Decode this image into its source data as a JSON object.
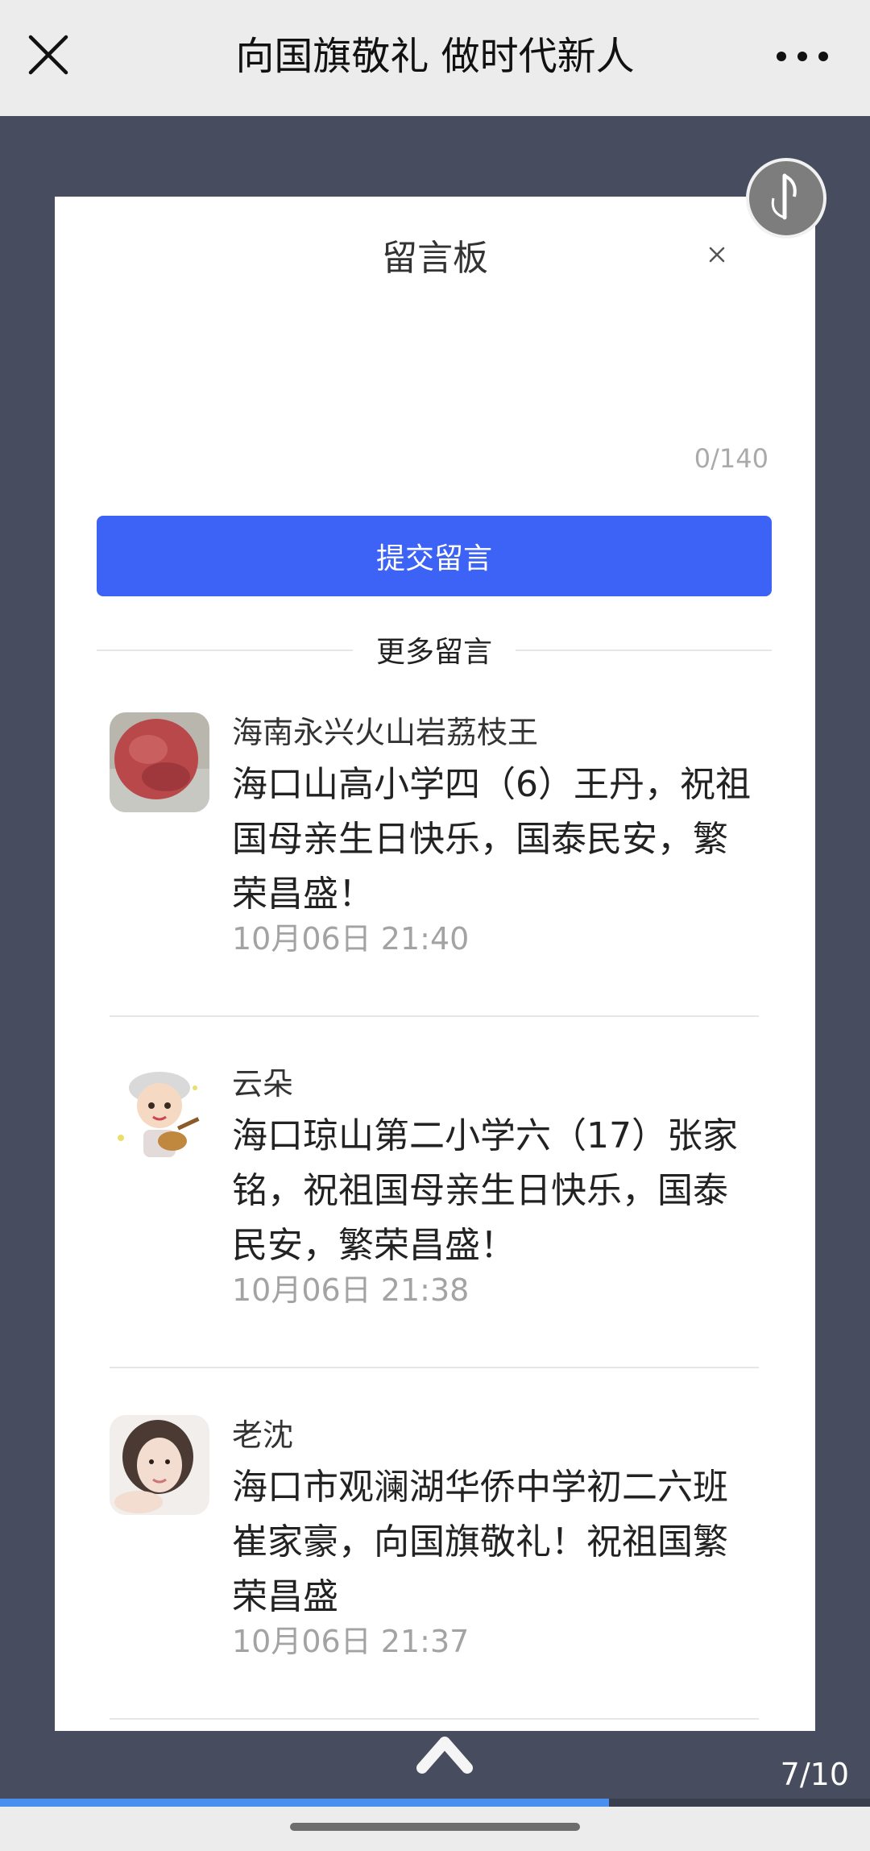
{
  "header": {
    "title": "向国旗敬礼 做时代新人",
    "close_icon": "close-icon",
    "more_icon": "more-dots-icon"
  },
  "music": {
    "icon": "music-note-icon"
  },
  "board": {
    "title": "留言板",
    "input_value": "",
    "counter": "0/140",
    "submit_label": "提交留言",
    "more_label": "更多留言",
    "accent_color": "#3d63f6"
  },
  "comments": [
    {
      "name": "海南永兴火山岩荔枝王",
      "message": "海口山高小学四（6）王丹，祝祖国母亲生日快乐，国泰民安，繁荣昌盛！",
      "time": "10月06日 21:40",
      "avatar": "lychee-avatar"
    },
    {
      "name": "云朵",
      "message": "海口琼山第二小学六（17）张家铭，祝祖国母亲生日快乐，国泰民安，繁荣昌盛！",
      "time": "10月06日 21:38",
      "avatar": "cartoon-guitar-avatar"
    },
    {
      "name": "老沈",
      "message": "海口市观澜湖华侨中学初二六班崔家豪，向国旗敬礼！祝祖国繁荣昌盛",
      "time": "10月06日 21:37",
      "avatar": "portrait-avatar"
    }
  ],
  "footer": {
    "page_indicator": "7/10",
    "progress_fraction": 0.7,
    "up_icon": "chevron-up-icon"
  }
}
